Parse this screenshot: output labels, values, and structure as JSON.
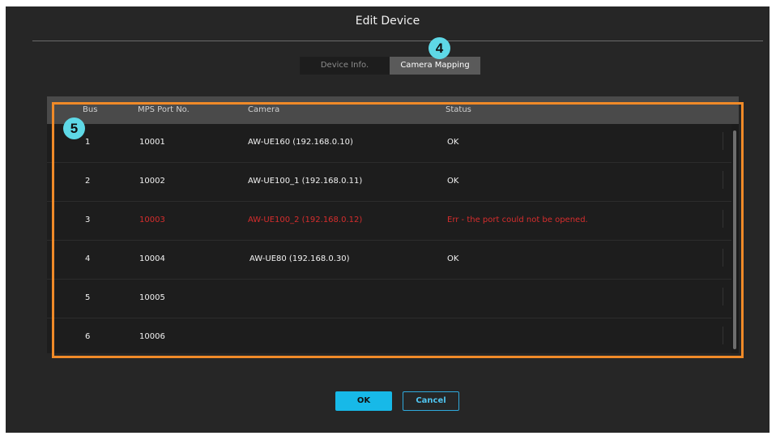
{
  "dialog": {
    "title": "Edit Device",
    "tabs": [
      {
        "label": "Device Info.",
        "active": false
      },
      {
        "label": "Camera Mapping",
        "active": true
      }
    ]
  },
  "table": {
    "headers": [
      "Bus",
      "MPS Port No.",
      "Camera",
      "Status"
    ],
    "rows": [
      {
        "bus": "1",
        "port": "10001",
        "camera": "AW-UE160 (192.168.0.10)",
        "status": "OK",
        "error": false
      },
      {
        "bus": "2",
        "port": "10002",
        "camera": "AW-UE100_1 (192.168.0.11)",
        "status": "OK",
        "error": false
      },
      {
        "bus": "3",
        "port": "10003",
        "camera": "AW-UE100_2 (192.168.0.12)",
        "status": "Err - the port could not be opened.",
        "error": true
      },
      {
        "bus": "4",
        "port": "10004",
        "camera": "AW-UE80 (192.168.0.30)",
        "status": "OK",
        "error": false
      },
      {
        "bus": "5",
        "port": "10005",
        "camera": "",
        "status": "",
        "error": false
      },
      {
        "bus": "6",
        "port": "10006",
        "camera": "",
        "status": "",
        "error": false
      }
    ]
  },
  "annotations": {
    "badge_tab": "4",
    "badge_table": "5",
    "highlight_color": "#f08a28",
    "badge_color": "#5ed8e6"
  },
  "colors": {
    "error_text": "#d62d2d",
    "ok_button": "#17b9e8"
  },
  "buttons": {
    "ok": "OK",
    "cancel": "Cancel"
  }
}
